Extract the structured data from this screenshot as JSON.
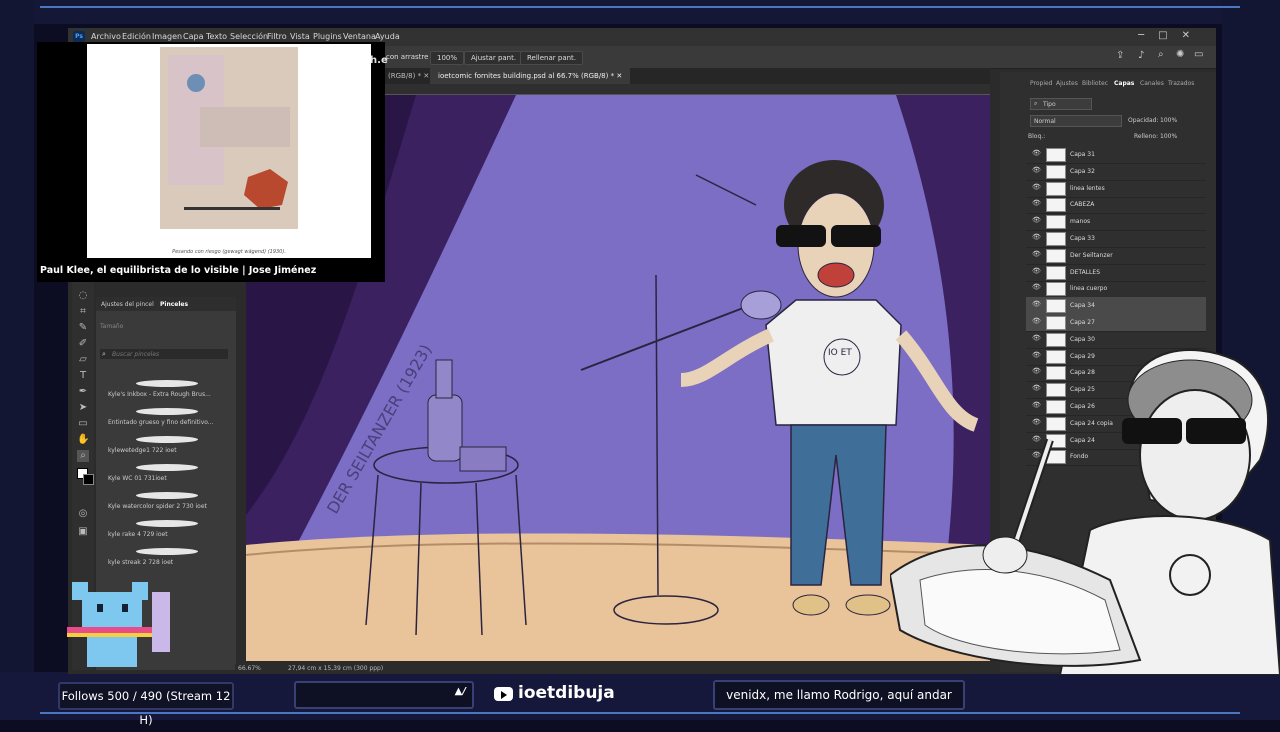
{
  "app": {
    "menu": [
      "Archivo",
      "Edición",
      "Imagen",
      "Capa",
      "Texto",
      "Selección",
      "Filtro",
      "Vista",
      "Plugins",
      "Ventana",
      "Ayuda"
    ],
    "options_bar": {
      "scroll_label": "con arrastre",
      "zoom_value": "100%",
      "fit_button": "Ajustar pant.",
      "fill_button": "Rellenar pant."
    },
    "tabs": [
      "(RGB/8) *",
      "ioetcomic fornites building.psd al 66.7% (RGB/8) *"
    ],
    "status": {
      "zoom": "66.67%",
      "doc_size": "27,94 cm x 15,39 cm (300 ppp)"
    }
  },
  "brush_panel": {
    "tabs": [
      "Ajustes del pincel",
      "Pinceles"
    ],
    "size_label": "Tamaño",
    "search_placeholder": "Buscar pinceles",
    "brushes": [
      "Kyle's Inkbox - Extra Rough Brus...",
      "Entintado grueso y fino definitivo...",
      "kylewetedge1 722 ioet",
      "Kyle WC 01 731ioet",
      "Kyle watercolor spider 2 730 ioet",
      "kyle rake 4 729 ioet",
      "kyle streak 2 728 ioet"
    ]
  },
  "layers_panel": {
    "tabs": [
      "Propied",
      "Ajustes",
      "Bibliotec",
      "Capas",
      "Canales",
      "Trazados"
    ],
    "kind_filter": "Tipo",
    "blend_mode": "Normal",
    "opacity_label": "Opacidad:",
    "opacity_value": "100%",
    "fill_label": "Relleno:",
    "fill_value": "100%",
    "lock_label": "Bloq.:",
    "layers": [
      "Capa 31",
      "Capa 32",
      "linea lentes",
      "CABEZA",
      "manos",
      "Capa 33",
      "Der Seiltanzer",
      "DETALLES",
      "linea cuerpo",
      "Capa 34",
      "Capa 27",
      "Capa 30",
      "Capa 29",
      "Capa 28",
      "Capa 25",
      "Capa 26",
      "Capa 24 copia",
      "Capa 24",
      "Fondo"
    ]
  },
  "video": {
    "caption": "Paul Klee, el equilibrista de lo visible | Jose Jiménez",
    "painting_caption": "Pesando con riesgo (gewagt wägend) (1930).",
    "watermark": "march.e"
  },
  "canvas": {
    "lettering": "DER SEILTANZER (1923)",
    "shirt_text": "IO ET"
  },
  "stream": {
    "follows": "Follows 500 / 490 (Stream 12 H)",
    "handle": "ioetdibuja",
    "chat_message": "venidx, me llamo Rodrigo, aquí andar"
  },
  "colors": {
    "accent": "#4a78c0",
    "canvas_bg": "#7b6ec4",
    "stage_floor": "#e9c49a"
  }
}
